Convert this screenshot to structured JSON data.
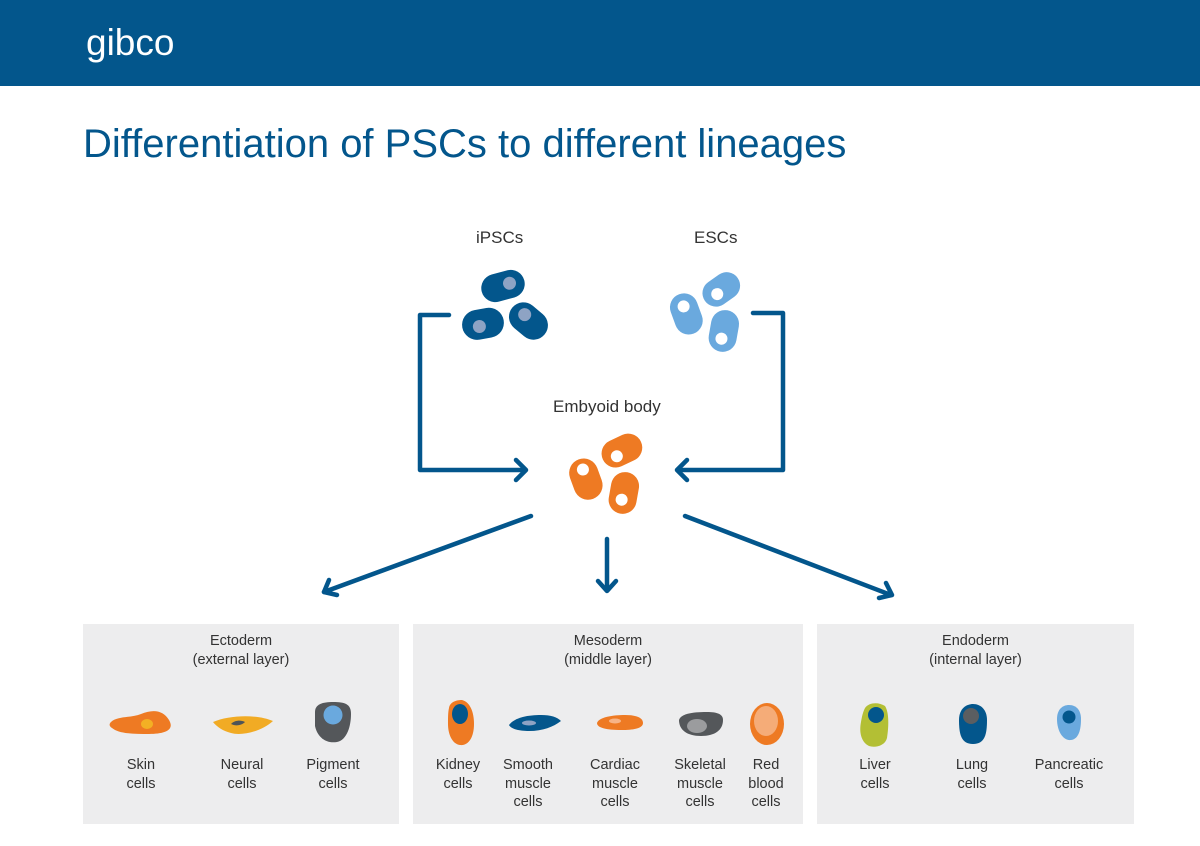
{
  "header": {
    "brand": "gibco"
  },
  "title": "Differentiation of PSCs to different lineages",
  "sources": {
    "ipscs": "iPSCs",
    "escs": "ESCs",
    "embryoid": "Embyoid body"
  },
  "colors": {
    "brand_blue": "#03568c",
    "light_blue": "#6aa9de",
    "orange": "#ee7a23",
    "panel_bg": "#ededee"
  },
  "layers": {
    "ectoderm": {
      "title": "Ectoderm",
      "subtitle": "(external layer)",
      "cells": [
        {
          "line1": "Skin",
          "line2": "cells"
        },
        {
          "line1": "Neural",
          "line2": "cells"
        },
        {
          "line1": "Pigment",
          "line2": "cells"
        }
      ]
    },
    "mesoderm": {
      "title": "Mesoderm",
      "subtitle": "(middle layer)",
      "cells": [
        {
          "line1": "Kidney",
          "line2": "cells",
          "line3": ""
        },
        {
          "line1": "Smooth",
          "line2": "muscle",
          "line3": "cells"
        },
        {
          "line1": "Cardiac",
          "line2": "muscle",
          "line3": "cells"
        },
        {
          "line1": "Skeletal",
          "line2": "muscle",
          "line3": "cells"
        },
        {
          "line1": "Red",
          "line2": "blood",
          "line3": "cells"
        }
      ]
    },
    "endoderm": {
      "title": "Endoderm",
      "subtitle": "(internal layer)",
      "cells": [
        {
          "line1": "Liver",
          "line2": "cells"
        },
        {
          "line1": "Lung",
          "line2": "cells"
        },
        {
          "line1": "Pancreatic",
          "line2": "cells"
        }
      ]
    }
  }
}
